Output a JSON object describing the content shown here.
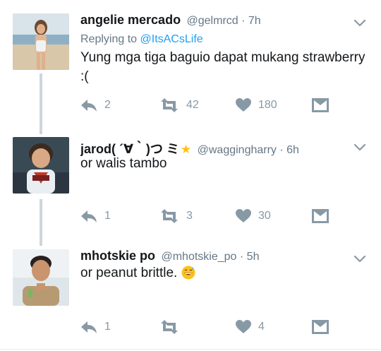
{
  "tweets": [
    {
      "name": "angelie mercado",
      "handle": "@gelmrcd",
      "separator": "·",
      "time": "7h",
      "replying_prefix": "Replying to ",
      "replying_to": "@ItsACsLife",
      "text": "Yung mga tiga baguio dapat mukang strawberry :(",
      "replies": "2",
      "retweets": "42",
      "likes": "180"
    },
    {
      "name": "jarod( ´∀｀)つ ミ",
      "name_emoji": "star",
      "handle": "@waggingharry",
      "separator": "·",
      "time": "6h",
      "text": "or walis tambo",
      "replies": "1",
      "retweets": "3",
      "likes": "30"
    },
    {
      "name": "mhotskie po",
      "handle": "@mhotskie_po",
      "separator": "·",
      "time": "5h",
      "text": "or peanut brittle.",
      "text_emoji": "grinning-sweat-face",
      "replies": "1",
      "retweets": "",
      "likes": "4"
    }
  ],
  "icons": [
    "reply-icon",
    "retweet-icon",
    "like-icon",
    "direct-message-icon",
    "chevron-down-icon"
  ],
  "colors": {
    "link": "#1da1f2",
    "muted": "#657786",
    "action": "#8899a6",
    "thread_line": "#ccd6dd",
    "star": "#ffc107"
  }
}
